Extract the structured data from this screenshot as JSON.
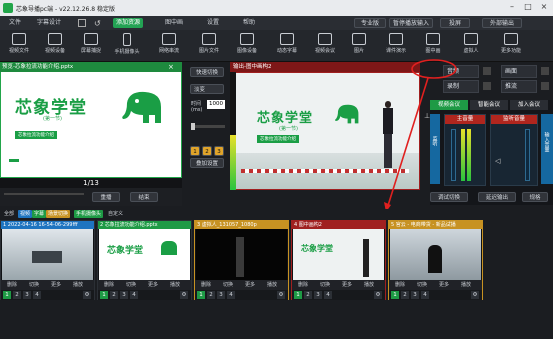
{
  "titlebar": {
    "title": "芯象导播pc端 - v22.12.26.8 稳定版"
  },
  "menu": {
    "items": [
      "文件",
      "字幕设计",
      "添加资源",
      "图中画",
      "设置",
      "帮助"
    ],
    "right": {
      "mode": "专业版",
      "status": "暂停播放输入",
      "cast": "投屏",
      "output": "外部输出"
    }
  },
  "toolbar": {
    "left": [
      "视频文件",
      "视频设备",
      "屏幕捕捉",
      "手机摄像头",
      "网络串流",
      "图片文件",
      "图像设备",
      "动态字幕",
      "视频会议"
    ],
    "right": [
      "图片",
      "课件演示",
      "图中画",
      "虚拟人",
      "更多功能"
    ]
  },
  "preview": {
    "title": "预览-芯象拉流功能介绍.pptx",
    "slide": {
      "heading": "芯象学堂",
      "sub": "(第一节)",
      "tag": "芯象拉流功能介绍"
    },
    "page": "1/13",
    "buttons": {
      "play": "重播",
      "stop": "结束"
    }
  },
  "mid": {
    "switch": "快速切换",
    "mode": "淡变",
    "time_label": "时间(ms)",
    "time_value": "1000",
    "nums": [
      "1",
      "2",
      "3"
    ],
    "add": "叠加设置"
  },
  "program": {
    "title": "输出-图中画构2",
    "slide": {
      "heading": "芯象学堂",
      "sub": "(第一节)",
      "tag": "芯象拉流功能介绍"
    }
  },
  "sources": {
    "items": [
      "音频",
      "录制",
      "画面",
      "推流"
    ]
  },
  "audio": {
    "tabs": [
      "视频会议",
      "智能会议",
      "加入会议"
    ],
    "channels": [
      "主音量",
      "监听音量"
    ],
    "side": [
      "监听",
      "输入音量"
    ],
    "links": [
      "调试切换",
      "延迟输出",
      "规格"
    ]
  },
  "strip": {
    "head": {
      "all": "全部",
      "video": "视频",
      "sub": "字幕",
      "scene": "场景切换",
      "mobile": "手机摄像头",
      "custom": "自定义"
    },
    "scenes": [
      {
        "caption": "1 2022-04-16 16-54-06-299fff",
        "kind": "desk"
      },
      {
        "caption": "2 芯象拉流功能介绍.pptx",
        "kind": "slide"
      },
      {
        "caption": "3 虚拟人_131057_1080p",
        "kind": "black"
      },
      {
        "caption": "4 图中画构2",
        "kind": "combo"
      },
      {
        "caption": "5 官云 - 电商带货 - 新品试播",
        "kind": "room"
      }
    ],
    "ctl": [
      "删除",
      "切换",
      "更多",
      "播放"
    ],
    "nums": [
      "1",
      "2",
      "3",
      "4"
    ]
  }
}
